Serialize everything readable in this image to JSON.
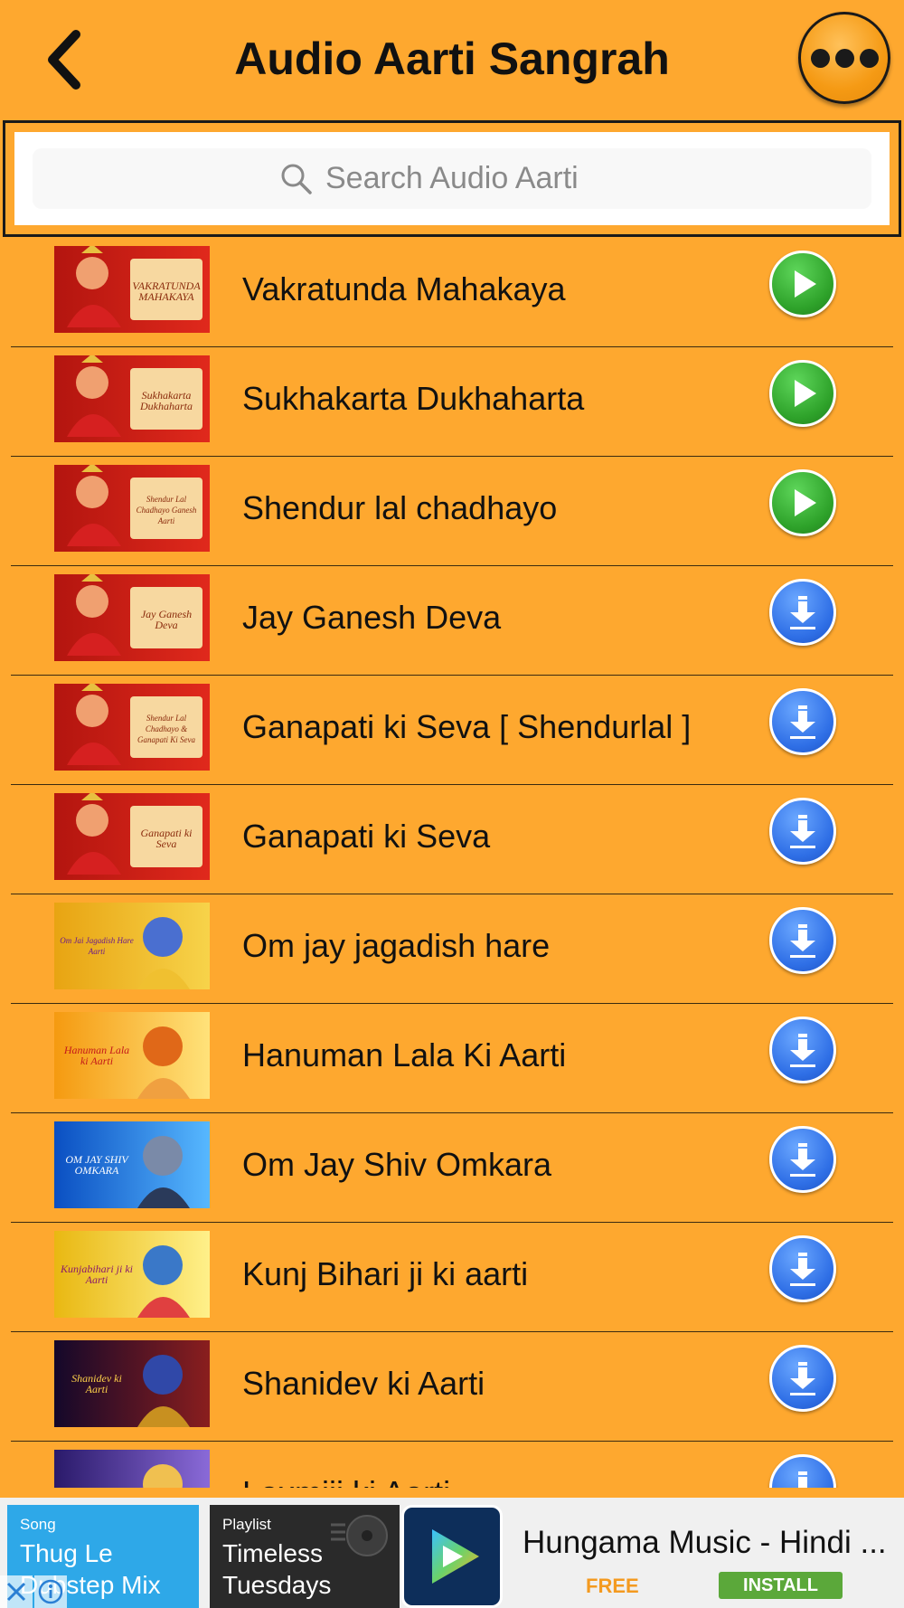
{
  "header": {
    "title": "Audio Aarti Sangrah",
    "back_icon": "chevron-left-icon",
    "menu_icon": "more-dots-icon"
  },
  "search": {
    "placeholder": "Search Audio Aarti",
    "value": ""
  },
  "list": {
    "items": [
      {
        "label": "Vakratunda Mahakaya",
        "action": "play",
        "thumb_text": "VAKRATUNDA MAHAKAYA",
        "thumb": "ganesh"
      },
      {
        "label": "Sukhakarta Dukhaharta",
        "action": "play",
        "thumb_text": "Sukhakarta Dukhaharta",
        "thumb": "ganesh"
      },
      {
        "label": "Shendur lal chadhayo",
        "action": "play",
        "thumb_text": "Shendur Lal Chadhayo Ganesh Aarti",
        "thumb": "ganesh"
      },
      {
        "label": "Jay Ganesh Deva",
        "action": "download",
        "thumb_text": "Jay Ganesh Deva",
        "thumb": "ganesh"
      },
      {
        "label": "Ganapati ki Seva [ Shendurlal ]",
        "action": "download",
        "thumb_text": "Shendur Lal Chadhayo & Ganapati Ki Seva",
        "thumb": "ganesh"
      },
      {
        "label": "Ganapati ki Seva",
        "action": "download",
        "thumb_text": "Ganapati ki Seva",
        "thumb": "ganesh"
      },
      {
        "label": "Om jay jagadish hare",
        "action": "download",
        "thumb_text": "Om Jai Jagadish Hare Aarti",
        "thumb": "vishnu"
      },
      {
        "label": "Hanuman Lala Ki Aarti",
        "action": "download",
        "thumb_text": "Hanuman Lala ki Aarti",
        "thumb": "hanuman"
      },
      {
        "label": "Om Jay Shiv Omkara",
        "action": "download",
        "thumb_text": "OM JAY SHIV OMKARA",
        "thumb": "shiv"
      },
      {
        "label": "Kunj Bihari ji ki aarti",
        "action": "download",
        "thumb_text": "Kunjabihari ji ki Aarti",
        "thumb": "krishna"
      },
      {
        "label": "Shanidev ki Aarti",
        "action": "download",
        "thumb_text": "Shanidev ki Aarti",
        "thumb": "shani"
      },
      {
        "label": "Laxmiji ki Aarti",
        "action": "download",
        "thumb_text": "",
        "thumb": "laxmi"
      }
    ]
  },
  "ad": {
    "song_kicker": "Song",
    "song_name_1": "Thug Le",
    "song_name_2": "Dubstep Mix",
    "playlist_kicker": "Playlist",
    "playlist_name_1": "Timeless",
    "playlist_name_2": "Tuesdays",
    "app_title": "Hungama Music - Hindi ...",
    "price": "FREE",
    "install_label": "INSTALL",
    "close_icon": "close-icon",
    "info_icon": "info-icon"
  },
  "colors": {
    "background": "#fea82f",
    "play_button": "#2ea22a",
    "download_button": "#2f6fe6",
    "install_button": "#5ba83a",
    "free_label": "#f49a20"
  }
}
